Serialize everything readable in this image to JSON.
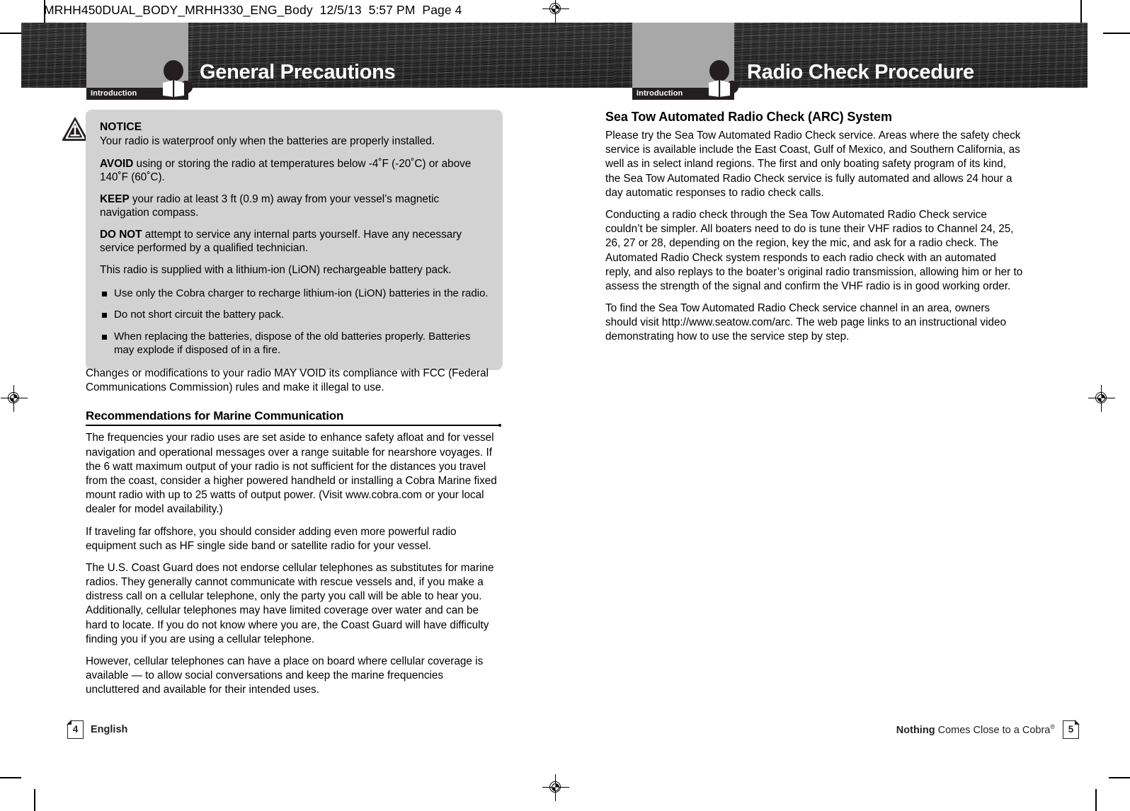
{
  "file_info": "MRHH450DUAL_BODY_MRHH330_ENG_Body  12/5/13  5:57 PM  Page 4",
  "left_page": {
    "banner": {
      "tab_label": "Introduction",
      "title": "General Precautions",
      "icon": "person-reading-book-icon"
    },
    "notice": {
      "icon": "warning-triangle-icon",
      "title": "NOTICE",
      "intro": "Your radio is waterproof only when the batteries are properly installed.",
      "paragraphs": [
        {
          "lead": "AVOID",
          "text": " using or storing the radio at temperatures below -4˚F (-20˚C) or above 140˚F (60˚C)."
        },
        {
          "lead": "KEEP",
          "text": " your radio at least 3 ft (0.9 m) away from your vessel’s magnetic navigation compass."
        },
        {
          "lead": "DO NOT",
          "text": " attempt to service any internal parts yourself. Have any necessary service performed by a qualified technician."
        },
        {
          "lead": "",
          "text": "This radio is supplied with a lithium-ion (LiON) rechargeable battery pack."
        }
      ],
      "bullets": [
        "Use only the Cobra charger to recharge lithium-ion (LiON) batteries in the radio.",
        "Do not short circuit the battery pack.",
        "When replacing the batteries, dispose of the old batteries properly. Batteries may explode if disposed of in a fire."
      ]
    },
    "fcc_notice": "Changes or modifications to your radio MAY VOID its compliance with FCC (Federal Communications Commission) rules and make it illegal to use.",
    "section": {
      "heading": "Recommendations for Marine Communication",
      "paragraphs": [
        "The frequencies your radio uses are set aside to enhance safety afloat and for vessel navigation and operational messages over a range suitable for nearshore voyages. If the 6 watt maximum output of your radio is not sufficient for the distances you travel from the coast, consider a higher powered handheld or installing a Cobra Marine fixed mount radio with up to 25 watts of output power. (Visit www.cobra.com or your local dealer for model availability.)",
        "If traveling far offshore, you should consider adding even more powerful radio equipment such as HF single side band or satellite radio for your vessel.",
        "The U.S. Coast Guard does not endorse cellular telephones as substitutes for marine radios. They generally cannot communicate with rescue vessels and, if you make a distress call on a cellular telephone, only the party you call will be able to hear you. Additionally, cellular telephones may have limited coverage over water and can be hard to locate. If you do not know where you are, the Coast Guard will have difficulty finding you if you are using a cellular telephone.",
        "However, cellular telephones can have a place on board where cellular coverage is available — to allow social conversations and keep the marine frequencies uncluttered and available for their intended uses."
      ]
    },
    "footer": {
      "page_number": "4",
      "language": "English"
    }
  },
  "right_page": {
    "banner": {
      "tab_label": "Introduction",
      "title": "Radio Check Procedure",
      "icon": "person-reading-book-icon"
    },
    "section": {
      "heading": "Sea Tow Automated Radio Check (ARC) System",
      "paragraphs": [
        "Please try the Sea Tow Automated Radio Check service. Areas where the safety check service is available include the East Coast, Gulf of Mexico, and Southern California, as well as in select inland regions. The first and only boating safety program of its kind, the Sea Tow Automated Radio Check service is fully automated and allows 24 hour a day automatic responses to radio check calls.",
        "Conducting a radio check through the Sea Tow Automated Radio Check service couldn’t be simpler. All boaters need to do is tune their VHF radios to Channel 24, 25, 26, 27 or 28, depending on the region, key the mic, and ask for a radio check. The Automated Radio Check system responds to each radio check with an automated reply, and also replays to the boater’s original radio transmission, allowing him or her to assess the strength of the signal and confirm the VHF radio is in good working order.",
        "To find the Sea Tow Automated Radio Check service channel in an area, owners should visit http://www.seatow.com/arc. The web page links to an instructional video demonstrating how to use the service step by step."
      ]
    },
    "footer": {
      "page_number": "5",
      "tagline_bold": "Nothing",
      "tagline_rest": " Comes Close to a Cobra",
      "tagline_mark": "®"
    }
  },
  "colors": {
    "banner_dark": "#2a2a2a",
    "tab_gray": "#a8a8a8",
    "tab_label_bg": "#231f20",
    "notice_bg": "#d2d2d2",
    "text": "#000000"
  }
}
